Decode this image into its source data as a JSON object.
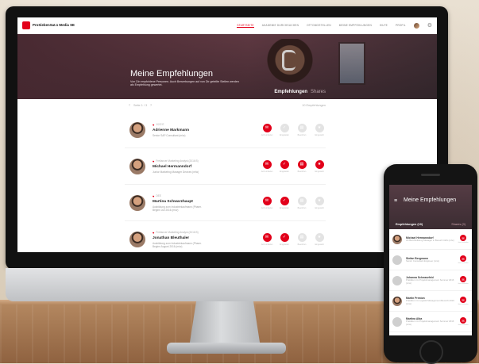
{
  "colors": {
    "accent": "#e2001a",
    "hero_bg": "#553c44"
  },
  "nav": {
    "logo": "ProSiebenSat.1 Media SE",
    "items": [
      "STARTSEITE",
      "AKADEMIE DURCHSUCHEN",
      "OTTOMOSTELLEN",
      "MEINE EMPFEHLUNGEN",
      "HILFE",
      "PROFIL"
    ]
  },
  "hero": {
    "title": "Meine Empfehlungen",
    "subtitle": "Von Dir empfohlene Personen. Auch Bewerbungen auf von Dir geteilte Stellen werden als Empfehlung gewertet.",
    "tabs": [
      "Empfehlungen",
      "Shares"
    ]
  },
  "list": {
    "pager": "Seite 1 / 3",
    "count": "10 Empfehlungen",
    "rows": [
      {
        "meta": "1/2/2 E",
        "name": "Adrienne Markmann",
        "desc": "Senior SAP Consultant (m/w)",
        "actions": [
          {
            "icon": "✉",
            "label": "Jetzt einladen",
            "on": true
          },
          {
            "icon": "✓",
            "label": "Eingeladen",
            "on": false
          },
          {
            "icon": "▤",
            "label": "Beworben",
            "on": false
          },
          {
            "icon": "★",
            "label": "Eingestellt",
            "on": false
          }
        ]
      },
      {
        "meta": "Freilancer Marketing Analyst (2016 B)",
        "name": "Michael Hermanndorf",
        "desc": "Junior Marketing Manager Devices (m/w)",
        "actions": [
          {
            "icon": "✉",
            "label": "Jetzt einladen",
            "on": true
          },
          {
            "icon": "✓",
            "label": "Eingeladen",
            "on": true
          },
          {
            "icon": "▤",
            "label": "Beworben",
            "on": true
          },
          {
            "icon": "★",
            "label": "Eingestellt",
            "on": true
          }
        ]
      },
      {
        "meta": "DEE",
        "name": "Martina Schwarzhaupt",
        "desc": "Ausbildung zum Industriekaufmann (Pharm. Beginn Juli 2016 (m/w)",
        "actions": [
          {
            "icon": "✉",
            "label": "Jetzt einladen",
            "on": true
          },
          {
            "icon": "✓",
            "label": "Eingeladen",
            "on": true
          },
          {
            "icon": "▤",
            "label": "Beworben",
            "on": false
          },
          {
            "icon": "★",
            "label": "Eingestellt",
            "on": false
          }
        ]
      },
      {
        "meta": "Freilancer Marketing Analyst (2016 B)",
        "name": "Jonathan Bleuthaler",
        "desc": "Ausbildung zum Industriekaufmann (Pharm. Beginn August 2016 (m/w)",
        "actions": [
          {
            "icon": "✉",
            "label": "Jetzt einladen",
            "on": true
          },
          {
            "icon": "✓",
            "label": "Eingeladen",
            "on": true
          },
          {
            "icon": "▤",
            "label": "Beworben",
            "on": false
          },
          {
            "icon": "★",
            "label": "Eingestellt",
            "on": false
          }
        ]
      }
    ]
  },
  "phone": {
    "title": "Meine Empfehlungen",
    "tabs": [
      "Empfehlungen (10)",
      "Shares (0)"
    ],
    "rows": [
      {
        "name": "Michael Hermanndorf",
        "desc": "Ab Berufsbildung Manager in Bereich CES (m/w)",
        "label": "Jetzt einladen",
        "img": true
      },
      {
        "name": "Stefan Bergmann",
        "desc": "Senior Consultant Engineer (m/w)",
        "label": "Jetzt einladen",
        "img": false
      },
      {
        "name": "Johanna Schwarzfeld",
        "desc": "Praktikum im Projektmanagement Sommer 2016 (m/w)",
        "label": "Jetzt einladen",
        "img": false
      },
      {
        "name": "Martin Preston",
        "desc": "Praktikum im Logistik Management Bereich 2016 (m/w)",
        "label": "Jetzt einladen",
        "img": true
      },
      {
        "name": "Martina Alba",
        "desc": "Praktikum im Projektmanagement Sommer 2016 (m/w)",
        "label": "Jetzt einladen",
        "img": false
      }
    ]
  }
}
